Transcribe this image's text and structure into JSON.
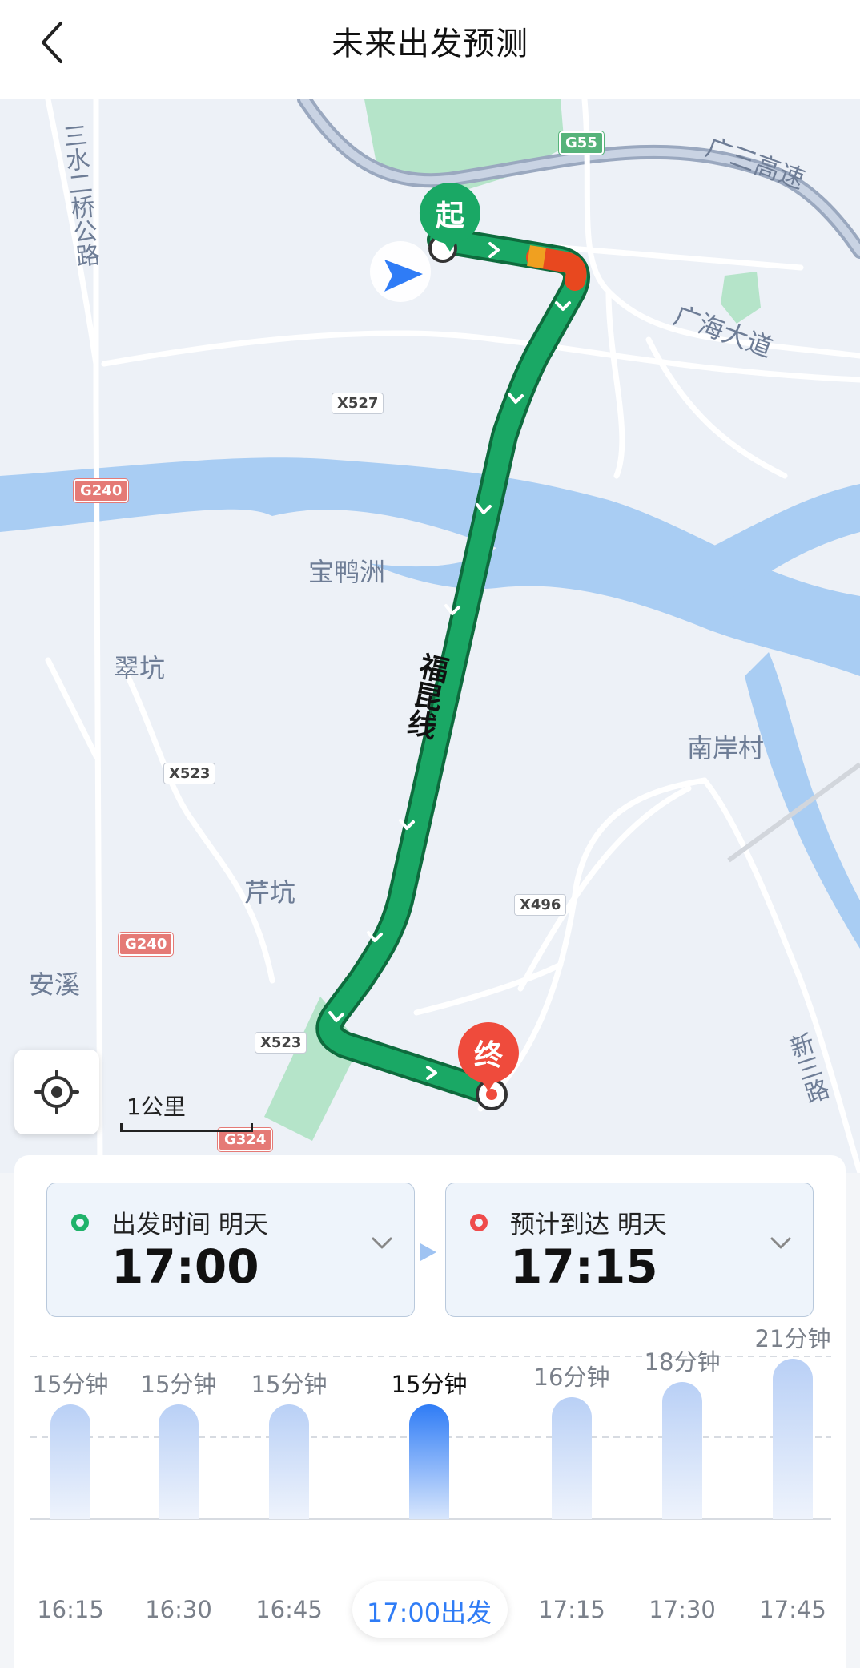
{
  "header": {
    "title": "未来出发预测",
    "back_icon": "chevron-left-icon"
  },
  "map": {
    "labels": {
      "sanshui_bridge": "三水二桥公路",
      "guangsan": "广三高速",
      "guanghai": "广海大道",
      "baoya": "宝鸭洲",
      "cuikeng": "翠坑",
      "nanan": "南岸村",
      "qiankeng": "芹坑",
      "anxi": "安溪",
      "xinsan": "新三路",
      "route_name": "福昆线"
    },
    "badges": {
      "g55": "G55",
      "x527": "X527",
      "g240_top": "G240",
      "x523_a": "X523",
      "g240_bottom": "G240",
      "x496": "X496",
      "x523_b": "X523",
      "g324": "G324"
    },
    "start_marker": "起",
    "end_marker": "终",
    "scale": "1公里",
    "colors": {
      "route": "#1aa865",
      "route_border": "#0e6b3d",
      "water": "#a9cdf3",
      "jam": "#e8481f"
    }
  },
  "panel": {
    "departure": {
      "label": "出发时间  明天",
      "time": "17:00"
    },
    "arrival": {
      "label": "预计到达  明天",
      "time": "17:15"
    },
    "selected_index": 3,
    "bars": [
      {
        "time": "16:15",
        "duration": "15分钟",
        "minutes": 15
      },
      {
        "time": "16:30",
        "duration": "15分钟",
        "minutes": 15
      },
      {
        "time": "16:45",
        "duration": "15分钟",
        "minutes": 15
      },
      {
        "time": "17:00出发",
        "duration": "15分钟",
        "minutes": 15
      },
      {
        "time": "17:15",
        "duration": "16分钟",
        "minutes": 16
      },
      {
        "time": "17:30",
        "duration": "18分钟",
        "minutes": 18
      },
      {
        "time": "17:45",
        "duration": "21分钟",
        "minutes": 21
      }
    ]
  }
}
